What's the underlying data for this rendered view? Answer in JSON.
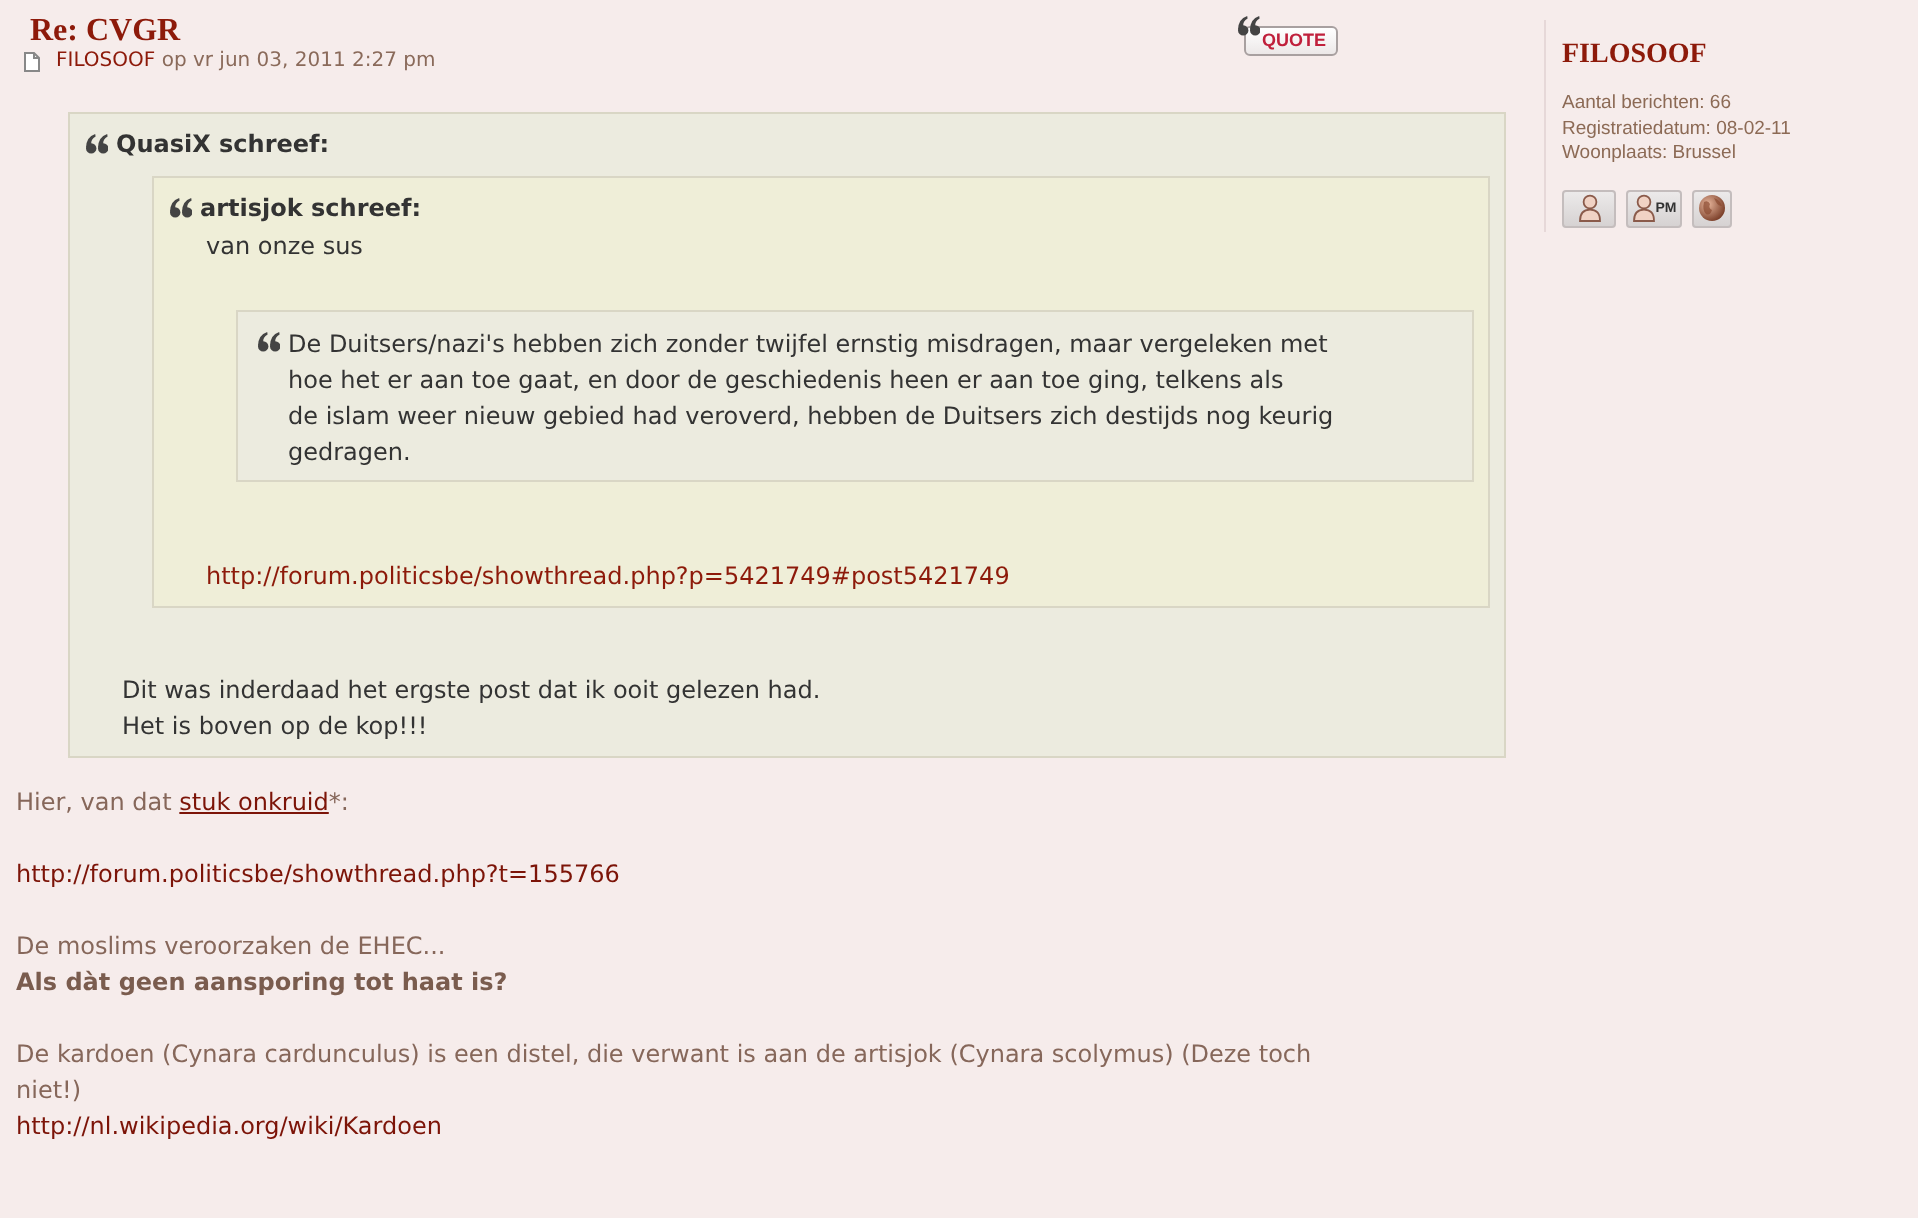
{
  "post": {
    "title": "Re: CVGR",
    "author": "FILOSOOF",
    "meta": "op vr jun 03, 2011 2:27 pm",
    "quote_button": "QUOTE"
  },
  "quote": {
    "author": "QuasiX schreef:",
    "quote": {
      "author": "artisjok schreef:",
      "lines": [
        "van onze sus"
      ],
      "quote": {
        "lines": [
          "De Duitsers/nazi's hebben zich zonder twijfel ernstig misdragen, maar vergeleken met",
          "hoe het er aan toe gaat, en door de geschiedenis heen er aan toe ging, telkens als",
          "de islam weer nieuw gebied had veroverd, hebben de Duitsers zich destijds nog keurig",
          "gedragen."
        ]
      },
      "link": "http://forum.politicsbe/showthread.php?p=5421749#post5421749"
    },
    "lines": [
      "Dit was inderdaad het ergste post dat ik ooit gelezen had.",
      "Het is boven op de kop!!!"
    ]
  },
  "body": [
    {
      "lines": [
        {
          "kind": "text_with_link",
          "before": "Hier, van dat ",
          "link": "stuk onkruid",
          "after": "*:"
        }
      ]
    },
    {
      "lines": [
        {
          "kind": "link",
          "text": "http://forum.politicsbe/showthread.php?t=155766"
        }
      ]
    },
    {
      "lines": [
        {
          "kind": "text",
          "text": "De moslims veroorzaken de EHEC..."
        },
        {
          "kind": "bold",
          "text": "Als dàt geen aansporing tot haat is?"
        }
      ]
    },
    {
      "lines": [
        {
          "kind": "text",
          "text": "De kardoen (Cynara cardunculus) is een distel, die verwant is aan de artisjok (Cynara scolymus) (Deze toch"
        },
        {
          "kind": "text",
          "text": "niet!)"
        },
        {
          "kind": "link",
          "text": "http://nl.wikipedia.org/wiki/Kardoen"
        }
      ]
    }
  ],
  "profile": {
    "username": "FILOSOOF",
    "stats": [
      "Aantal berichten: 66",
      "Registratiedatum: 08-02-11",
      "Woonplaats: Brussel"
    ],
    "buttons": [
      {
        "kind": "profile"
      },
      {
        "kind": "pm",
        "label": "PM"
      },
      {
        "kind": "website"
      }
    ]
  }
}
